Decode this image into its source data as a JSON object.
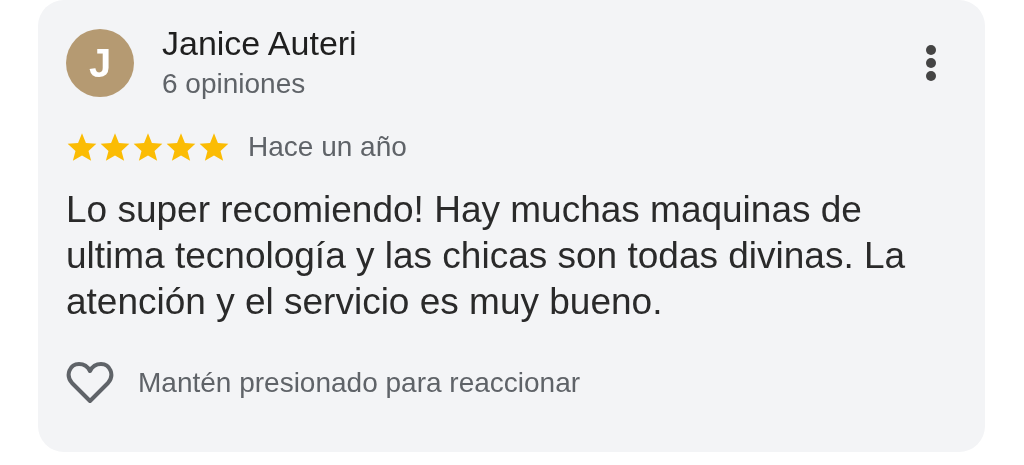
{
  "review": {
    "avatar_letter": "J",
    "author": "Janice Auteri",
    "review_count": "6 opiniones",
    "stars": 5,
    "time": "Hace un año",
    "text": "Lo super recomiendo! Hay muchas maquinas de ultima tecnología y las chicas son todas divinas. La atención y el servicio es muy bueno.",
    "reaction_hint": "Mantén presionado para reaccionar"
  }
}
